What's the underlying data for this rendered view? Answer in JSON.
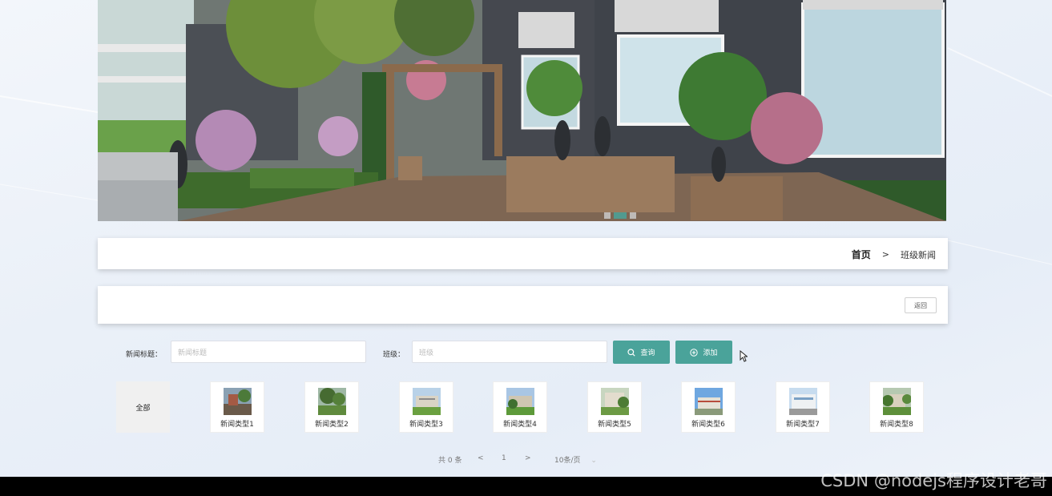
{
  "breadcrumb": {
    "home": "首页",
    "separator": ">",
    "current": "班级新闻"
  },
  "actions": {
    "back_label": "返回"
  },
  "search": {
    "title_label": "新闻标题：",
    "title_placeholder": "新闻标题",
    "class_label": "班级：",
    "class_placeholder": "班级",
    "query_label": "查询",
    "add_label": "添加"
  },
  "categories": {
    "all_label": "全部",
    "items": [
      {
        "label": "新闻类型1",
        "icon": "building-photo"
      },
      {
        "label": "新闻类型2",
        "icon": "building-photo"
      },
      {
        "label": "新闻类型3",
        "icon": "building-photo"
      },
      {
        "label": "新闻类型4",
        "icon": "building-photo"
      },
      {
        "label": "新闻类型5",
        "icon": "building-photo"
      },
      {
        "label": "新闻类型6",
        "icon": "building-photo"
      },
      {
        "label": "新闻类型7",
        "icon": "building-photo"
      },
      {
        "label": "新闻类型8",
        "icon": "building-photo"
      }
    ]
  },
  "pagination": {
    "total": "共 0 条",
    "prev": "<",
    "page": "1",
    "next": ">",
    "page_size": "10条/页"
  },
  "carousel": {
    "slides": 3,
    "active_index": 1
  },
  "watermark": "CSDN @nodejs程序设计老哥",
  "colors": {
    "accent": "#4aa39a",
    "bottom_bar": "#000000"
  }
}
